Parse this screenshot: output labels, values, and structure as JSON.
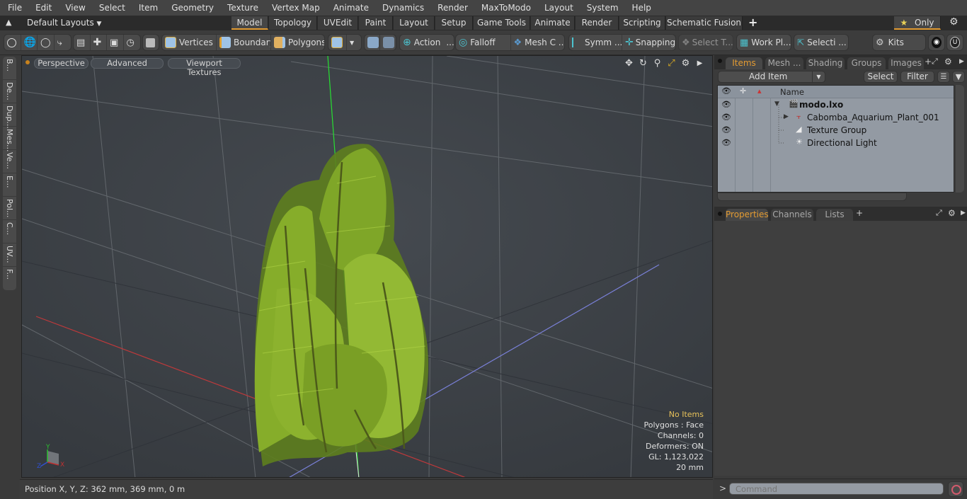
{
  "menubar": {
    "items": [
      "File",
      "Edit",
      "View",
      "Select",
      "Item",
      "Geometry",
      "Texture",
      "Vertex Map",
      "Animate",
      "Dynamics",
      "Render",
      "MaxToModo",
      "Layout",
      "System",
      "Help"
    ]
  },
  "layoutbar": {
    "layouts_dropdown": "Default Layouts",
    "tabs": [
      "Model",
      "Topology",
      "UVEdit",
      "Paint",
      "Layout",
      "Setup",
      "Game Tools",
      "Animate",
      "Render",
      "Scripting",
      "Schematic Fusion"
    ],
    "active_tab": "Model",
    "add_tab": "+",
    "only_label": "Only"
  },
  "toolbar": {
    "vertices": "Vertices",
    "boundary": "Boundary",
    "polygons": "Polygons",
    "action": "Action",
    "action_more": "...",
    "falloff": "Falloff",
    "mesh_constraints": "Mesh C ...",
    "symmetry": "Symm ...",
    "snapping": "Snapping",
    "select_through": "Select T...",
    "work_plane": "Work Pl...",
    "selection_sets": "Selecti ...",
    "kits": "Kits"
  },
  "left_tabs": [
    "B...",
    "De...",
    "Dup...",
    "Mes...",
    "Ve...",
    "E...",
    "Pol...",
    "C...",
    "UV...",
    "F..."
  ],
  "viewport": {
    "view_mode": "Perspective",
    "shading": "Advanced",
    "textures": "Viewport Textures",
    "info": {
      "selection": "No Items",
      "polygons": "Polygons : Face",
      "channels": "Channels: 0",
      "deformers": "Deformers: ON",
      "gl": "GL: 1,123,022",
      "grid": "20 mm"
    },
    "axis_labels": {
      "x": "X",
      "y": "Y",
      "z": "Z"
    }
  },
  "statusbar": {
    "position": "Position X, Y, Z:   362 mm, 369 mm, 0 m"
  },
  "right_panel": {
    "top_tabs": [
      "Items",
      "Mesh ...",
      "Shading",
      "Groups",
      "Images"
    ],
    "active_top_tab": "Items",
    "add_item": "Add Item",
    "select": "Select",
    "filter": "Filter",
    "column_name": "Name",
    "items": [
      {
        "name": "modo.lxo",
        "level": 0,
        "expanded": true,
        "bold": true,
        "icon": "scene-icon"
      },
      {
        "name": "Cabomba_Aquarium_Plant_001",
        "level": 1,
        "expanded": false,
        "icon": "mesh-locator-icon"
      },
      {
        "name": "Texture Group",
        "level": 1,
        "icon": "texture-group-icon"
      },
      {
        "name": "Directional Light",
        "level": 1,
        "icon": "light-icon"
      }
    ],
    "bottom_tabs": [
      "Properties",
      "Channels",
      "Lists"
    ],
    "active_bottom_tab": "Properties",
    "command_placeholder": "Command",
    "command_prompt": ">"
  },
  "colors": {
    "accent": "#e39b32",
    "info_highlight": "#e8c25a",
    "viewport_bg": "#3e4247",
    "list_bg": "#939aa3"
  }
}
